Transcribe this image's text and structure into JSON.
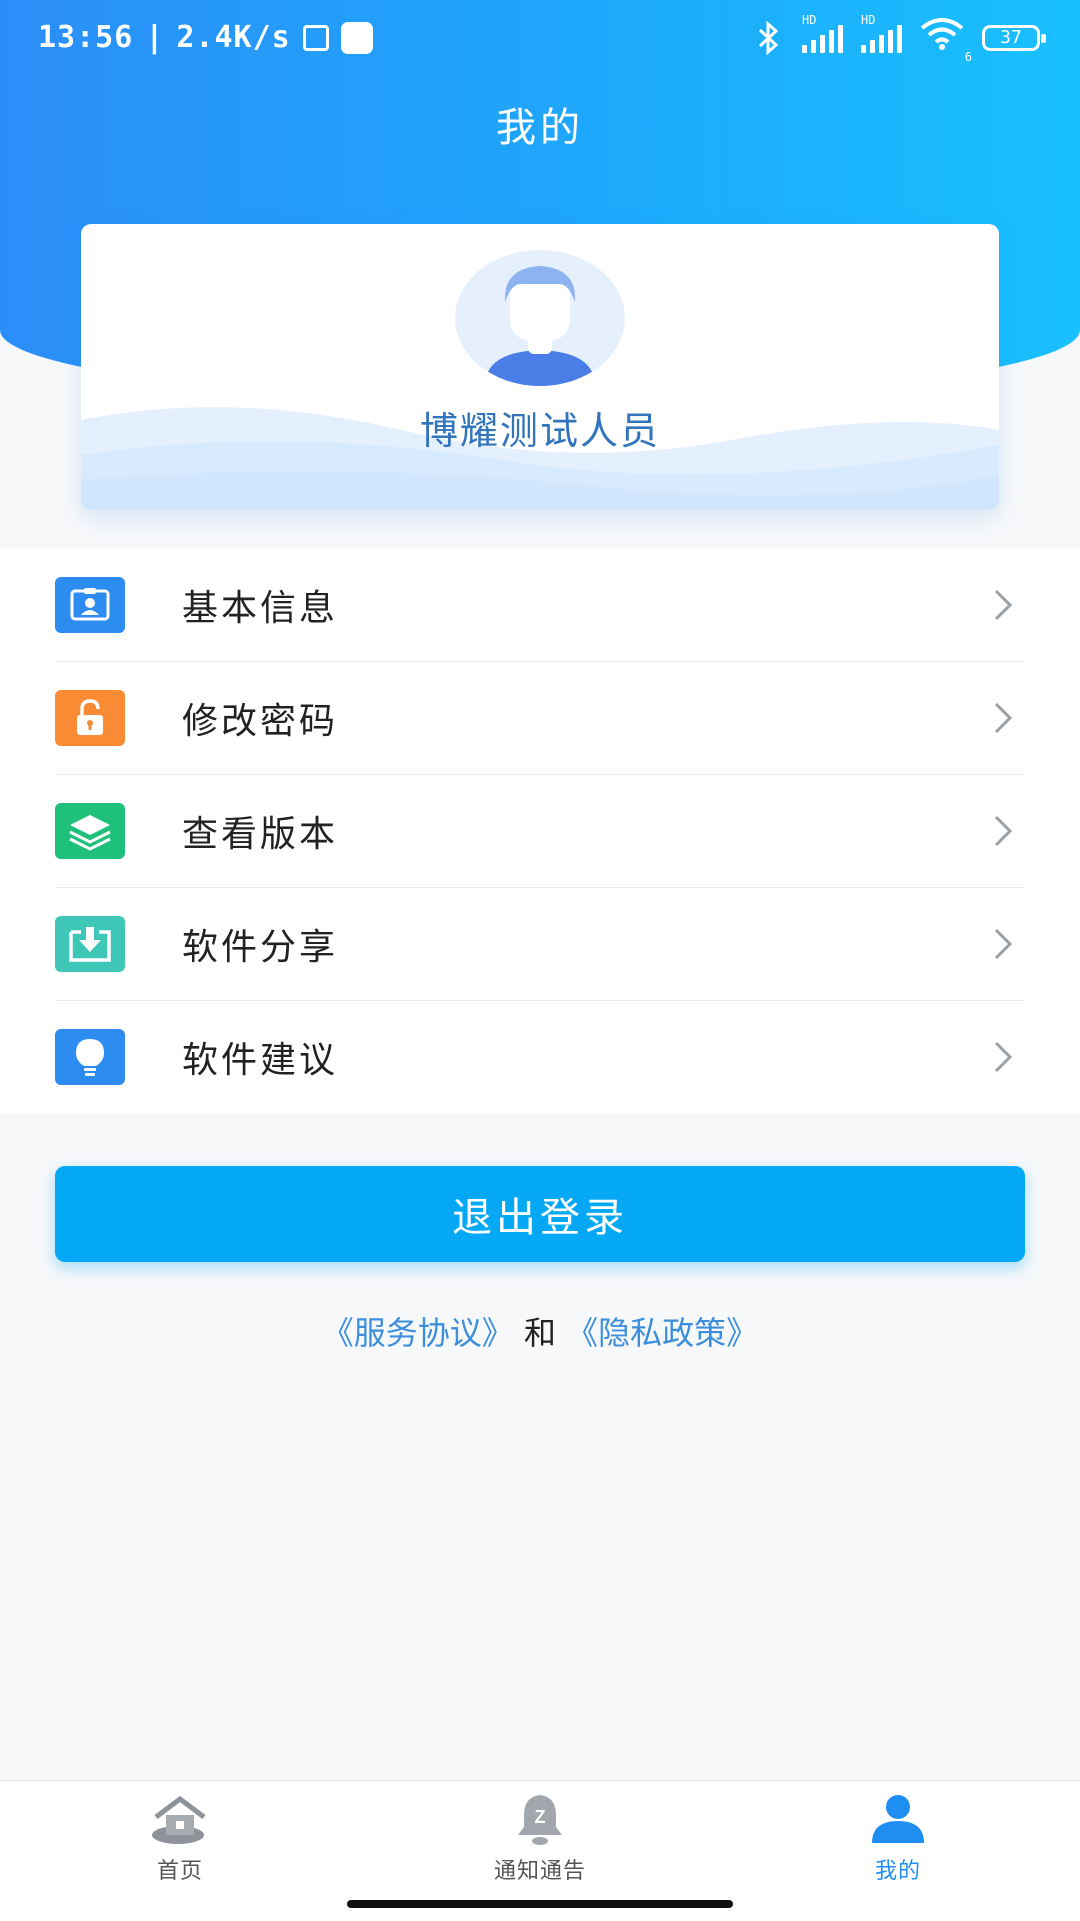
{
  "status_bar": {
    "time": "13:56",
    "network_speed": "2.4K/s",
    "signal_label_1": "HD",
    "signal_label_2": "HD",
    "wifi_sub": "6",
    "battery": "37"
  },
  "header": {
    "title": "我的"
  },
  "profile": {
    "name": "博耀测试人员"
  },
  "menu": {
    "items": [
      {
        "label": "基本信息",
        "icon": "id-card-icon",
        "color": "#2d8cf0"
      },
      {
        "label": "修改密码",
        "icon": "unlock-icon",
        "color": "#f98b34"
      },
      {
        "label": "查看版本",
        "icon": "layers-icon",
        "color": "#1ec07a"
      },
      {
        "label": "软件分享",
        "icon": "download-tray-icon",
        "color": "#3ec7b6"
      },
      {
        "label": "软件建议",
        "icon": "lightbulb-icon",
        "color": "#2d8cf0"
      }
    ]
  },
  "logout": {
    "label": "退出登录",
    "color": "#04a8f5"
  },
  "agreements": {
    "service": "《服务协议》",
    "and": "和",
    "privacy": "《隐私政策》"
  },
  "tabs": [
    {
      "label": "首页",
      "icon": "home-icon",
      "active": false
    },
    {
      "label": "通知通告",
      "icon": "bell-icon",
      "active": false
    },
    {
      "label": "我的",
      "icon": "user-icon",
      "active": true
    }
  ]
}
